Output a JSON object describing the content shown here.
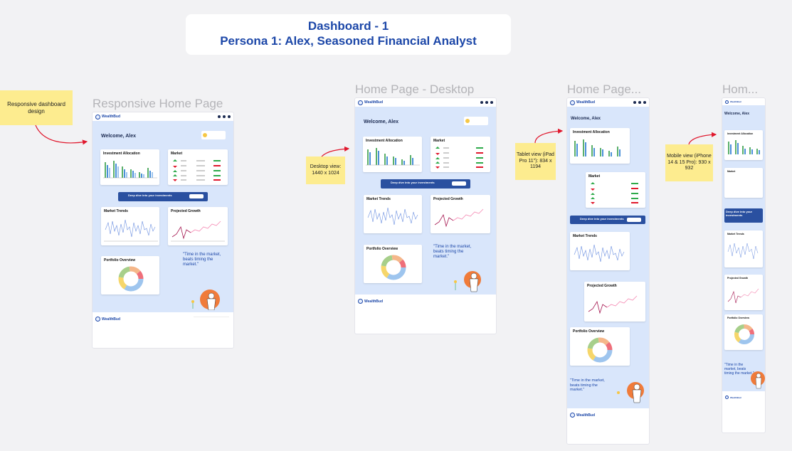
{
  "header": {
    "title_line1": "Dashboard - 1",
    "title_line2": "Persona 1: Alex, Seasoned Financial Analyst"
  },
  "frames": {
    "responsive": {
      "label": "Responsive Home Page"
    },
    "desktop": {
      "label": "Home Page - Desktop"
    },
    "tablet": {
      "label": "Home Page..."
    },
    "mobile": {
      "label": "Hom..."
    }
  },
  "stickies": {
    "responsive": "Responsive dashboard design",
    "desktop": "Desktop view: 1440 x 1024",
    "tablet": "Tablet view (iPad Pro 11\"): 834 x 1194",
    "mobile": "Mobile view (iPhone 14 & 15 Pro): 930 x 932"
  },
  "app": {
    "brand": "WealthBud",
    "welcome": "Welcome, Alex",
    "cards": {
      "allocation": "Investment Allocation",
      "market": "Market",
      "trends": "Market Trends",
      "growth": "Projected Growth",
      "portfolio": "Portfolio Overview"
    },
    "banner": "Deep dive into your investments",
    "quote": "\"Time in the market, beats timing the market.\""
  },
  "colors": {
    "accent": "#1c47a8",
    "frame_bg": "#d9e6fb",
    "sticky": "#fdec8f",
    "arrow": "#e0182d"
  }
}
